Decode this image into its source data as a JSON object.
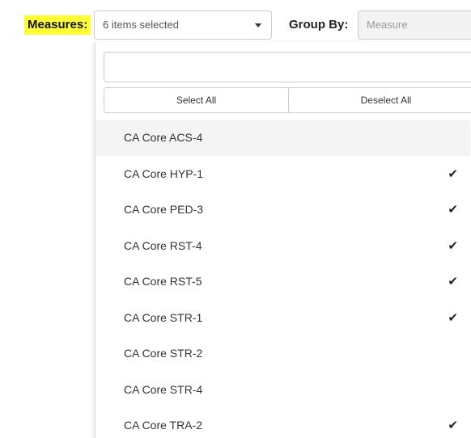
{
  "filters": {
    "measures_label": "Measures:",
    "measures_value": "6 items selected",
    "groupby_label": "Group By:",
    "groupby_value": "Measure"
  },
  "dropdown": {
    "search_placeholder": "",
    "select_all_label": "Select All",
    "deselect_all_label": "Deselect All",
    "options": [
      {
        "label": "CA Core ACS-4",
        "selected": false,
        "hovered": true
      },
      {
        "label": "CA Core HYP-1",
        "selected": true
      },
      {
        "label": "CA Core PED-3",
        "selected": true
      },
      {
        "label": "CA Core RST-4",
        "selected": true
      },
      {
        "label": "CA Core RST-5",
        "selected": true
      },
      {
        "label": "CA Core STR-1",
        "selected": true
      },
      {
        "label": "CA Core STR-2",
        "selected": false
      },
      {
        "label": "CA Core STR-4",
        "selected": false
      },
      {
        "label": "CA Core TRA-2",
        "selected": true
      }
    ]
  },
  "colors": {
    "highlight": "#ffff33",
    "hover_row": "#f4f4f4"
  },
  "icons": {
    "check": "✔",
    "caret": "caret-down-icon"
  }
}
